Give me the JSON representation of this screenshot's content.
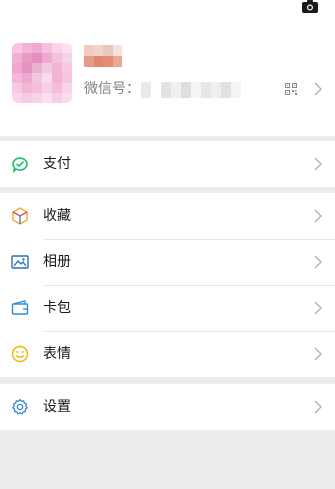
{
  "profile": {
    "wechat_id_label": "微信号：",
    "camera_icon": "camera-icon",
    "qr_icon": "qr-code-icon"
  },
  "menu": {
    "group1": [
      {
        "label": "支付",
        "icon": "wallet-icon",
        "color": "#07c160"
      }
    ],
    "group2": [
      {
        "label": "收藏",
        "icon": "favorites-cube-icon",
        "color": "#f5a623"
      },
      {
        "label": "相册",
        "icon": "photo-album-icon",
        "color": "#2c6fb8"
      },
      {
        "label": "卡包",
        "icon": "card-pack-icon",
        "color": "#2b8fd6"
      },
      {
        "label": "表情",
        "icon": "sticker-smile-icon",
        "color": "#f0b400"
      }
    ],
    "group3": [
      {
        "label": "设置",
        "icon": "settings-gear-icon",
        "color": "#2c7fd1"
      }
    ]
  },
  "colors": {
    "background": "#ededed",
    "surface": "#ffffff",
    "secondary_text": "#7f7f7f",
    "chevron": "#b2b2b2"
  }
}
